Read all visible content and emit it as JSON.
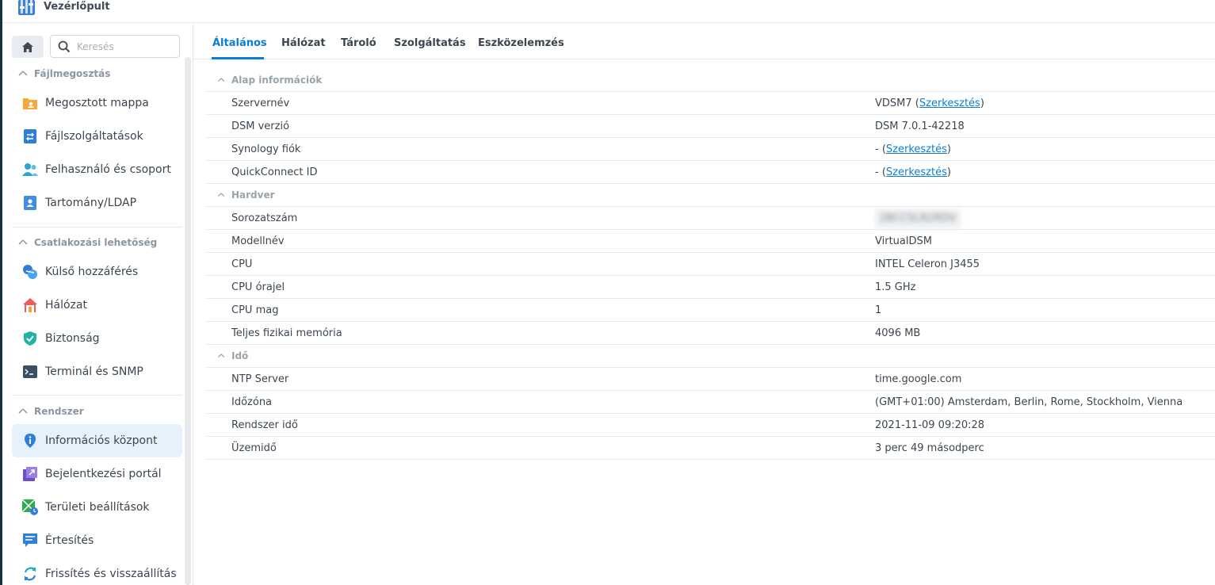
{
  "app": {
    "title": "Vezérlőpult"
  },
  "search": {
    "placeholder": "Keresés"
  },
  "sidebar": {
    "sections": [
      {
        "label": "Fájlmegosztás"
      },
      {
        "label": "Csatlakozási lehetőség"
      },
      {
        "label": "Rendszer"
      }
    ],
    "items": [
      {
        "label": "Megosztott mappa",
        "icon": "shared-folder-icon"
      },
      {
        "label": "Fájlszolgáltatások",
        "icon": "file-services-icon"
      },
      {
        "label": "Felhasználó és csoport",
        "icon": "users-icon"
      },
      {
        "label": "Tartomány/LDAP",
        "icon": "domain-icon"
      },
      {
        "label": "Külső hozzáférés",
        "icon": "external-access-icon"
      },
      {
        "label": "Hálózat",
        "icon": "network-house-icon"
      },
      {
        "label": "Biztonság",
        "icon": "shield-icon"
      },
      {
        "label": "Terminál és SNMP",
        "icon": "terminal-icon"
      },
      {
        "label": "Információs központ",
        "icon": "info-icon",
        "active": true
      },
      {
        "label": "Bejelentkezési portál",
        "icon": "login-portal-icon"
      },
      {
        "label": "Területi beállítások",
        "icon": "regional-icon"
      },
      {
        "label": "Értesítés",
        "icon": "notification-icon"
      },
      {
        "label": "Frissítés és visszaállítás",
        "icon": "update-icon"
      }
    ]
  },
  "tabs": [
    {
      "label": "Általános",
      "active": true
    },
    {
      "label": "Hálózat"
    },
    {
      "label": "Tároló"
    },
    {
      "label": "Szolgáltatás"
    },
    {
      "label": "Eszközelemzés"
    }
  ],
  "groups": {
    "basic": {
      "title": "Alap információk",
      "rows": [
        {
          "key": "Szervernév",
          "value": "VDSM7",
          "link": "Szerkesztés"
        },
        {
          "key": "DSM verzió",
          "value": "DSM 7.0.1-42218"
        },
        {
          "key": "Synology fiók",
          "value": "-",
          "link": "Szerkesztés"
        },
        {
          "key": "QuickConnect ID",
          "value": "-",
          "link": "Szerkesztés"
        }
      ]
    },
    "hardware": {
      "title": "Hardver",
      "rows": [
        {
          "key": "Sorozatszám",
          "value": "2BCCSLN2RDV"
        },
        {
          "key": "Modellnév",
          "value": "VirtualDSM"
        },
        {
          "key": "CPU",
          "value": "INTEL Celeron J3455"
        },
        {
          "key": "CPU órajel",
          "value": "1.5 GHz"
        },
        {
          "key": "CPU mag",
          "value": "1"
        },
        {
          "key": "Teljes fizikai memória",
          "value": "4096 MB"
        }
      ]
    },
    "time": {
      "title": "Idő",
      "rows": [
        {
          "key": "NTP Server",
          "value": "time.google.com"
        },
        {
          "key": "Időzóna",
          "value": "(GMT+01:00) Amsterdam, Berlin, Rome, Stockholm, Vienna"
        },
        {
          "key": "Rendszer idő",
          "value": "2021-11-09 09:20:28"
        },
        {
          "key": "Üzemidő",
          "value": "3 perc 49 másodperc"
        }
      ]
    }
  },
  "colors": {
    "accent": "#0a7dd6",
    "active_bg": "#e6f1fc"
  }
}
